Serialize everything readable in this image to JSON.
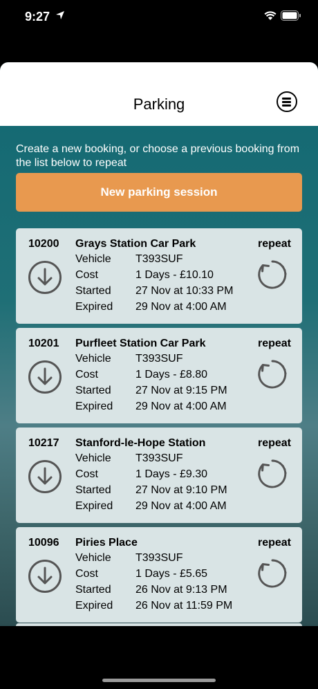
{
  "status_bar": {
    "time": "9:27"
  },
  "header": {
    "title": "Parking"
  },
  "intro_text": "Create a new booking, or choose a previous booking from the list below to repeat",
  "new_session_label": "New parking session",
  "bookings": [
    {
      "id": "10200",
      "name": "Grays Station Car Park",
      "repeat_label": "repeat",
      "vehicle_label": "Vehicle",
      "vehicle": "T393SUF",
      "cost_label": "Cost",
      "cost": "1 Days - £10.10",
      "started_label": "Started",
      "started": "27 Nov at 10:33 PM",
      "expired_label": "Expired",
      "expired": "29 Nov at 4:00 AM"
    },
    {
      "id": "10201",
      "name": "Purfleet Station Car Park",
      "repeat_label": "repeat",
      "vehicle_label": "Vehicle",
      "vehicle": "T393SUF",
      "cost_label": "Cost",
      "cost": "1 Days - £8.80",
      "started_label": "Started",
      "started": "27 Nov at 9:15 PM",
      "expired_label": "Expired",
      "expired": "29 Nov at 4:00 AM"
    },
    {
      "id": "10217",
      "name": "Stanford-le-Hope Station",
      "repeat_label": "repeat",
      "vehicle_label": "Vehicle",
      "vehicle": "T393SUF",
      "cost_label": "Cost",
      "cost": "1 Days - £9.30",
      "started_label": "Started",
      "started": "27 Nov at 9:10 PM",
      "expired_label": "Expired",
      "expired": "29 Nov at 4:00 AM"
    },
    {
      "id": "10096",
      "name": "Piries Place",
      "repeat_label": "repeat",
      "vehicle_label": "Vehicle",
      "vehicle": "T393SUF",
      "cost_label": "Cost",
      "cost": "1 Days - £5.65",
      "started_label": "Started",
      "started": "26 Nov at 9:13 PM",
      "expired_label": "Expired",
      "expired": "26 Nov at 11:59 PM"
    }
  ],
  "colors": {
    "accent": "#e8994f",
    "teal": "#1b6b72",
    "card": "#d9e4e5"
  }
}
